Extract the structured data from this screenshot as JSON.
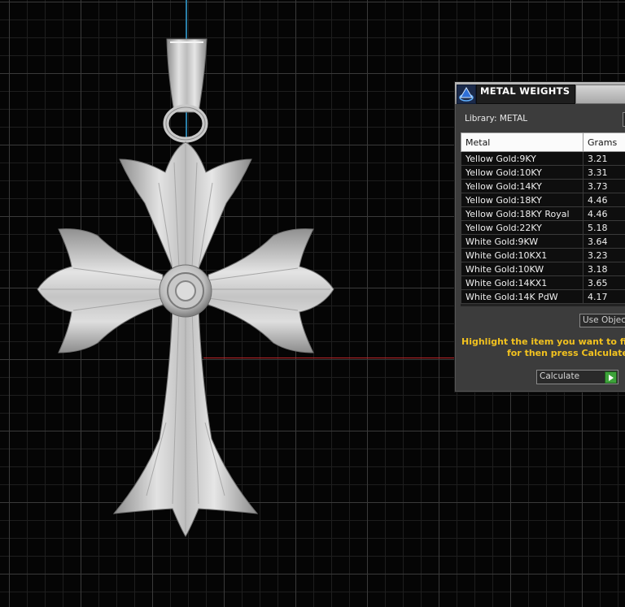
{
  "panel": {
    "title": "METAL WEIGHTS",
    "library_label": "Library: METAL",
    "columns": {
      "metal": "Metal",
      "grams": "Grams"
    },
    "rows": [
      {
        "metal": "Yellow Gold:9KY",
        "grams": "3.21"
      },
      {
        "metal": "Yellow Gold:10KY",
        "grams": "3.31"
      },
      {
        "metal": "Yellow Gold:14KY",
        "grams": "3.73"
      },
      {
        "metal": "Yellow Gold:18KY",
        "grams": "4.46"
      },
      {
        "metal": "Yellow Gold:18KY Royal",
        "grams": "4.46"
      },
      {
        "metal": "Yellow Gold:22KY",
        "grams": "5.18"
      },
      {
        "metal": "White Gold:9KW",
        "grams": "3.64"
      },
      {
        "metal": "White Gold:10KX1",
        "grams": "3.23"
      },
      {
        "metal": "White Gold:10KW",
        "grams": "3.18"
      },
      {
        "metal": "White Gold:14KX1",
        "grams": "3.65"
      },
      {
        "metal": "White Gold:14K PdW",
        "grams": "4.17"
      }
    ],
    "use_object_label": "Use Object",
    "instruction_line1": "Highlight the item you want to find",
    "instruction_line2": "for then press Calculate",
    "calculate_label": "Calculate"
  },
  "colors": {
    "instruction": "#f2c21f",
    "axis_y": "#2a7fa8",
    "axis_x": "#c0262a",
    "calculate_icon": "#3da33a"
  },
  "icons": {
    "panel_logo": "metal-weights-logo-icon",
    "calculate": "play-arrow-icon"
  }
}
